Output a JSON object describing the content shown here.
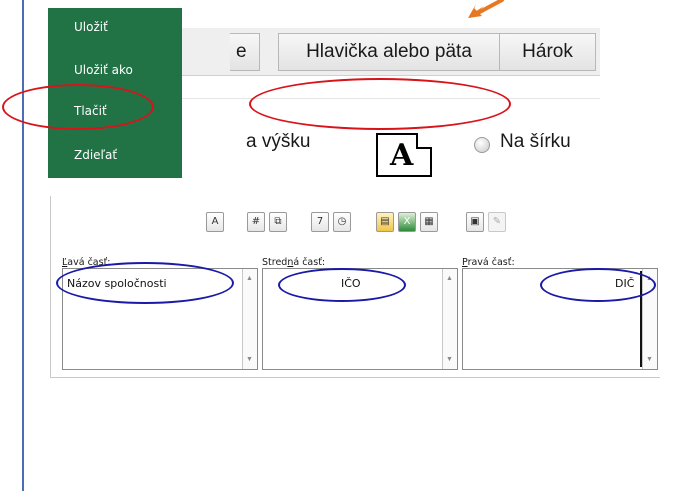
{
  "backstage_menu": {
    "items": [
      "Uložiť",
      "Uložiť ako",
      "Tlačiť",
      "Zdieľať"
    ]
  },
  "tabs": {
    "partial": "e",
    "header_footer": "Hlavička alebo päta",
    "sheet": "Hárok"
  },
  "orientation": {
    "portrait_partial": "a výšku",
    "landscape": "Na šírku"
  },
  "sections": {
    "left": {
      "label_prefix": "Ľ",
      "label_rest": "avá časť:",
      "value": "Názov spoločnosti"
    },
    "center": {
      "label_a": "Stred",
      "label_u": "n",
      "label_b": "á časť:",
      "value": "IČO"
    },
    "right": {
      "label_prefix": "P",
      "label_rest": "ravá časť:",
      "value": "DIČ"
    }
  },
  "toolbar_icons": [
    "font-icon",
    "page-number-icon",
    "number-of-pages-icon",
    "date-icon",
    "time-icon",
    "file-path-icon",
    "file-name-icon",
    "sheet-name-icon",
    "picture-icon",
    "format-picture-icon"
  ],
  "colors": {
    "menu_bg": "#217346",
    "annotation_red": "#d8141a",
    "annotation_blue": "#1a1aa8",
    "arrow": "#e87722"
  }
}
